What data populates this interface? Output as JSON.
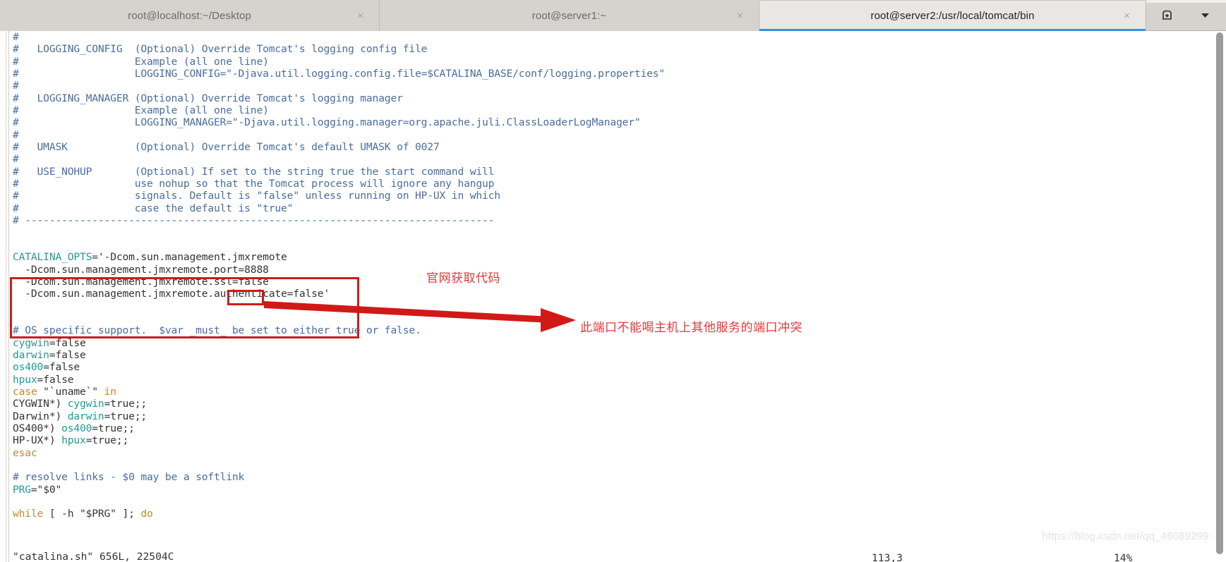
{
  "window": {
    "tabs": [
      {
        "label": "root@localhost:~/Desktop",
        "close": "×",
        "active": false
      },
      {
        "label": "root@server1:~",
        "close": "×",
        "active": false
      },
      {
        "label": "root@server2:/usr/local/tomcat/bin",
        "close": "×",
        "active": true
      }
    ],
    "actions": {
      "new_tab_icon": "new-tab-icon",
      "menu_icon": "chevron-down-icon"
    }
  },
  "editor": {
    "file_hint": "\"catalina.sh\" 656L, 22504C",
    "lines": [
      {
        "segs": [
          {
            "t": "#",
            "c": "c-comment"
          }
        ]
      },
      {
        "segs": [
          {
            "t": "#   LOGGING_CONFIG  (Optional) Override Tomcat's logging config file",
            "c": "c-comment"
          }
        ]
      },
      {
        "segs": [
          {
            "t": "#                   Example (all one line)",
            "c": "c-comment"
          }
        ]
      },
      {
        "segs": [
          {
            "t": "#                   LOGGING_CONFIG=\"-Djava.util.logging.config.file=$CATALINA_BASE/conf/logging.properties\"",
            "c": "c-comment"
          }
        ]
      },
      {
        "segs": [
          {
            "t": "#",
            "c": "c-comment"
          }
        ]
      },
      {
        "segs": [
          {
            "t": "#   LOGGING_MANAGER (Optional) Override Tomcat's logging manager",
            "c": "c-comment"
          }
        ]
      },
      {
        "segs": [
          {
            "t": "#                   Example (all one line)",
            "c": "c-comment"
          }
        ]
      },
      {
        "segs": [
          {
            "t": "#                   LOGGING_MANAGER=\"-Djava.util.logging.manager=org.apache.juli.ClassLoaderLogManager\"",
            "c": "c-comment"
          }
        ]
      },
      {
        "segs": [
          {
            "t": "#",
            "c": "c-comment"
          }
        ]
      },
      {
        "segs": [
          {
            "t": "#   UMASK           (Optional) Override Tomcat's default UMASK of 0027",
            "c": "c-comment"
          }
        ]
      },
      {
        "segs": [
          {
            "t": "#",
            "c": "c-comment"
          }
        ]
      },
      {
        "segs": [
          {
            "t": "#   USE_NOHUP       (Optional) If set to the string true the start command will",
            "c": "c-comment"
          }
        ]
      },
      {
        "segs": [
          {
            "t": "#                   use nohup so that the Tomcat process will ignore any hangup",
            "c": "c-comment"
          }
        ]
      },
      {
        "segs": [
          {
            "t": "#                   signals. Default is \"false\" unless running on HP-UX in which",
            "c": "c-comment"
          }
        ]
      },
      {
        "segs": [
          {
            "t": "#                   case the default is \"true\"",
            "c": "c-comment"
          }
        ]
      },
      {
        "segs": [
          {
            "t": "# -----------------------------------------------------------------------------",
            "c": "c-comment"
          }
        ]
      },
      {
        "segs": [
          {
            "t": "",
            "c": "c-plain"
          }
        ]
      },
      {
        "segs": [
          {
            "t": "",
            "c": "c-plain"
          }
        ]
      },
      {
        "segs": [
          {
            "t": "CATALINA_OPTS",
            "c": "c-var"
          },
          {
            "t": "='-Dcom.sun.management.jmxremote",
            "c": "c-plain"
          }
        ]
      },
      {
        "segs": [
          {
            "t": "  -Dcom.sun.management.jmxremote.port=8888",
            "c": "c-plain"
          }
        ]
      },
      {
        "segs": [
          {
            "t": "  -Dcom.sun.management.jmxremote.ssl=false",
            "c": "c-plain"
          }
        ]
      },
      {
        "segs": [
          {
            "t": "  -Dcom.sun.management.jmxremote.authenticate=false'",
            "c": "c-plain"
          }
        ]
      },
      {
        "segs": [
          {
            "t": "",
            "c": "c-plain"
          }
        ]
      },
      {
        "segs": [
          {
            "t": "",
            "c": "c-plain"
          }
        ]
      },
      {
        "segs": [
          {
            "t": "# OS specific support.  $var _must_ be set to either true or false.",
            "c": "c-comment"
          }
        ]
      },
      {
        "segs": [
          {
            "t": "cygwin",
            "c": "c-var"
          },
          {
            "t": "=false",
            "c": "c-plain"
          }
        ]
      },
      {
        "segs": [
          {
            "t": "darwin",
            "c": "c-var"
          },
          {
            "t": "=false",
            "c": "c-plain"
          }
        ]
      },
      {
        "segs": [
          {
            "t": "os400",
            "c": "c-var"
          },
          {
            "t": "=false",
            "c": "c-plain"
          }
        ]
      },
      {
        "segs": [
          {
            "t": "hpux",
            "c": "c-var"
          },
          {
            "t": "=false",
            "c": "c-plain"
          }
        ]
      },
      {
        "segs": [
          {
            "t": "case",
            "c": "c-kw"
          },
          {
            "t": " \"`uname`\" ",
            "c": "c-plain"
          },
          {
            "t": "in",
            "c": "c-kw"
          }
        ]
      },
      {
        "segs": [
          {
            "t": "CYGWIN*) ",
            "c": "c-plain"
          },
          {
            "t": "cygwin",
            "c": "c-var"
          },
          {
            "t": "=true;;",
            "c": "c-plain"
          }
        ]
      },
      {
        "segs": [
          {
            "t": "Darwin*) ",
            "c": "c-plain"
          },
          {
            "t": "darwin",
            "c": "c-var"
          },
          {
            "t": "=true;;",
            "c": "c-plain"
          }
        ]
      },
      {
        "segs": [
          {
            "t": "OS400*) ",
            "c": "c-plain"
          },
          {
            "t": "os400",
            "c": "c-var"
          },
          {
            "t": "=true;;",
            "c": "c-plain"
          }
        ]
      },
      {
        "segs": [
          {
            "t": "HP-UX*) ",
            "c": "c-plain"
          },
          {
            "t": "hpux",
            "c": "c-var"
          },
          {
            "t": "=true;;",
            "c": "c-plain"
          }
        ]
      },
      {
        "segs": [
          {
            "t": "esac",
            "c": "c-kw"
          }
        ]
      },
      {
        "segs": [
          {
            "t": "",
            "c": "c-plain"
          }
        ]
      },
      {
        "segs": [
          {
            "t": "# resolve links - $0 may be a softlink",
            "c": "c-comment"
          }
        ]
      },
      {
        "segs": [
          {
            "t": "PRG",
            "c": "c-var"
          },
          {
            "t": "=\"$0\"",
            "c": "c-plain"
          }
        ]
      },
      {
        "segs": [
          {
            "t": "",
            "c": "c-plain"
          }
        ]
      },
      {
        "segs": [
          {
            "t": "while",
            "c": "c-kw"
          },
          {
            "t": " [ -h \"$PRG\" ]; ",
            "c": "c-plain"
          },
          {
            "t": "do",
            "c": "c-kw"
          }
        ]
      }
    ]
  },
  "annotations": {
    "note_code_source": "官网获取代码",
    "note_port_conflict": "此端口不能喝主机上其他服务的端口冲突",
    "highlight_color": "#d11a18",
    "text_color": "#e03a36"
  },
  "statusbar": {
    "file_info": "\"catalina.sh\" 656L, 22504C",
    "position": "113,3",
    "percent": "14%"
  },
  "watermark": {
    "text": "https://blog.csdn.net/qq_46089299"
  }
}
